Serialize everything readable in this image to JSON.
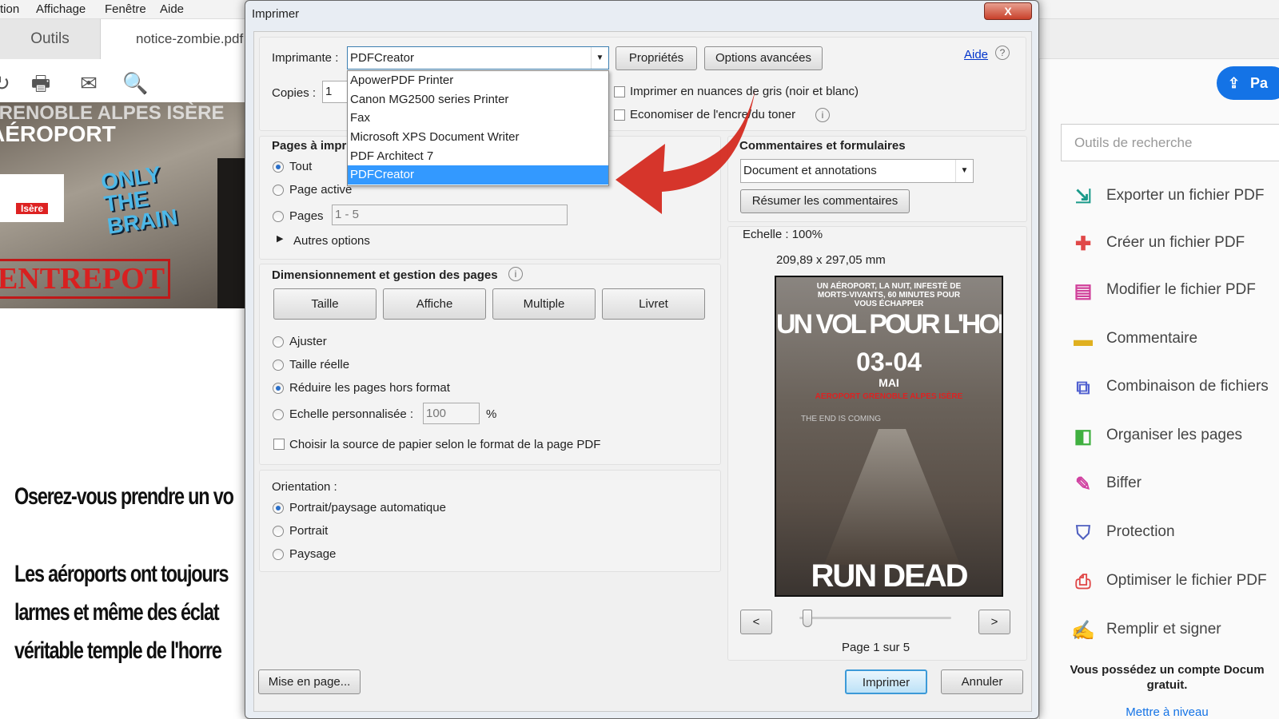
{
  "menubar": [
    "tion",
    "Affichage",
    "Fenêtre",
    "Aide"
  ],
  "tabs": {
    "tools": "Outils",
    "document": "notice-zombie.pdf"
  },
  "toolbar_icons": [
    "share-icon",
    "print-icon",
    "mail-icon",
    "zoom-icon"
  ],
  "background_poster": {
    "line1": "GRENOBLE ALPES ISÈRE",
    "line2": "AÉROPORT",
    "only_the_brain": "ONLY THE BRAIN",
    "entrepot": "ENTREPOT",
    "assoc": "Isère"
  },
  "document_text": [
    "Oserez-vous prendre un vo",
    "Les aéroports ont toujours",
    "larmes et même des éclat",
    "véritable temple de l'horre"
  ],
  "dialog": {
    "title": "Imprimer",
    "close": "X",
    "printer_label": "Imprimante :",
    "printer_value": "PDFCreator",
    "properties_button": "Propriétés",
    "advanced_button": "Options avancées",
    "help_link": "Aide",
    "printer_options": [
      "ApowerPDF Printer",
      "Canon MG2500 series Printer",
      "Fax",
      "Microsoft XPS Document Writer",
      "PDF Architect 7",
      "PDFCreator"
    ],
    "printer_selected_index": 5,
    "copies_label": "Copies :",
    "copies_value": "1",
    "grayscale_label": "Imprimer en nuances de gris (noir et blanc)",
    "grayscale_checked": false,
    "save_ink_label": "Economiser de l'encre/du toner",
    "save_ink_checked": false,
    "pages": {
      "heading": "Pages à imprimer",
      "all": "Tout",
      "current": "Page active",
      "pages": "Pages",
      "range_value": "1 - 5",
      "more": "Autres options",
      "selected": "Tout"
    },
    "sizing": {
      "heading": "Dimensionnement et gestion des pages",
      "buttons": [
        "Taille",
        "Affiche",
        "Multiple",
        "Livret"
      ],
      "options": [
        "Ajuster",
        "Taille réelle",
        "Réduire les pages hors format",
        "Echelle personnalisée :"
      ],
      "selected": "Réduire les pages hors format",
      "scale_value": "100",
      "percent": "%",
      "paper_source": "Choisir la source de papier selon le format de la page PDF",
      "paper_source_checked": false
    },
    "orientation": {
      "heading": "Orientation :",
      "options": [
        "Portrait/paysage automatique",
        "Portrait",
        "Paysage"
      ],
      "selected": "Portrait/paysage automatique"
    },
    "comments": {
      "heading": "Commentaires et formulaires",
      "value": "Document et annotations",
      "summarize_button": "Résumer les commentaires"
    },
    "preview": {
      "scale": "Echelle : 100%",
      "size": "209,89 x 297,05 mm",
      "page_label": "Page 1 sur 5",
      "prev": "<",
      "next": ">",
      "slider_fraction": 0,
      "poster": {
        "top": "UN AÉROPORT, LA NUIT, INFESTÉ DE MORTS-VIVANTS, 60 MINUTES POUR VOUS ÉCHAPPER",
        "title": "UN VOL POUR L'HORREU",
        "date": "03-04",
        "month": "MAI",
        "place": "AEROPORT GRENOBLE ALPES ISÈRE",
        "tagline": "THE END IS COMING",
        "bottom": "RUN DEAD"
      }
    },
    "page_setup_button": "Mise en page...",
    "print_button": "Imprimer",
    "cancel_button": "Annuler"
  },
  "sidebar": {
    "share_button": "Pa",
    "search_placeholder": "Outils de recherche",
    "tools": [
      {
        "label": "Exporter un fichier PDF",
        "icon": "export-pdf-icon",
        "color": "#1a9a8a"
      },
      {
        "label": "Créer un fichier PDF",
        "icon": "create-pdf-icon",
        "color": "#e04848"
      },
      {
        "label": "Modifier le fichier PDF",
        "icon": "edit-pdf-icon",
        "color": "#d0409a"
      },
      {
        "label": "Commentaire",
        "icon": "comment-icon",
        "color": "#e0b020"
      },
      {
        "label": "Combinaison de fichiers",
        "icon": "combine-icon",
        "color": "#5060d0"
      },
      {
        "label": "Organiser les pages",
        "icon": "organize-icon",
        "color": "#40b040"
      },
      {
        "label": "Biffer",
        "icon": "redact-icon",
        "color": "#d040a0"
      },
      {
        "label": "Protection",
        "icon": "shield-icon",
        "color": "#5060c0"
      },
      {
        "label": "Optimiser le fichier PDF",
        "icon": "optimize-icon",
        "color": "#e04848"
      },
      {
        "label": "Remplir et signer",
        "icon": "sign-icon",
        "color": "#8050d0"
      }
    ],
    "footer_line1": "Vous possédez un compte Docum",
    "footer_line2": "gratuit.",
    "upgrade_link": "Mettre à niveau"
  },
  "colors": {
    "accent": "#1473e6",
    "selection": "#3399ff",
    "arrow": "#d42a20"
  }
}
